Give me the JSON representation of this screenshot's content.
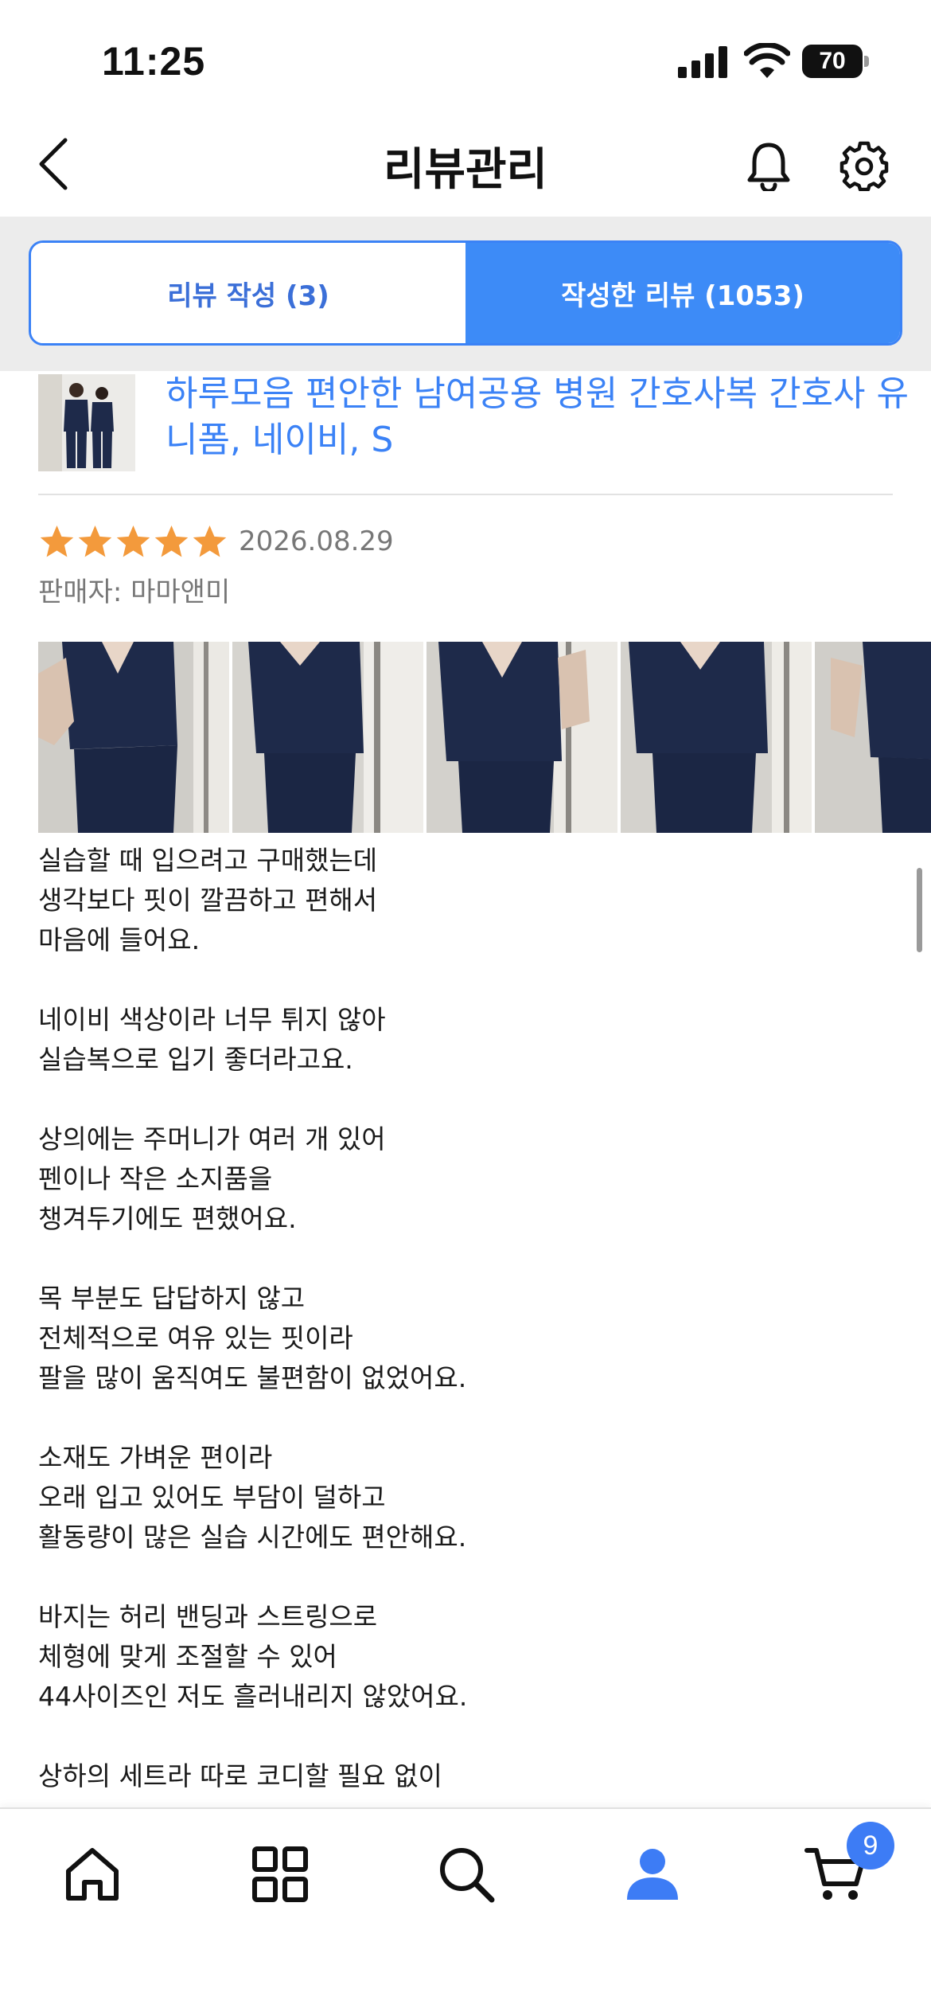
{
  "status_bar": {
    "time": "11:25",
    "battery": "70",
    "icons": [
      "signal-icon",
      "wifi-icon",
      "battery-icon"
    ]
  },
  "header": {
    "title": "리뷰관리",
    "icons": [
      "back-arrow-icon",
      "bell-icon",
      "gear-icon"
    ]
  },
  "tabs": [
    {
      "label": "리뷰 작성 (3)",
      "active": false
    },
    {
      "label": "작성한 리뷰 (1053)",
      "active": true
    }
  ],
  "review": {
    "product_title": "하루모음 편안한 남여공용 병원 간호사복 간호사 유니폼, 네이비, S",
    "rating": 5,
    "date": "2026.08.29",
    "seller": "판매자: 마마앤미",
    "photo_count_visible": 5,
    "text": "실습할 때 입으려고 구매했는데\n생각보다 핏이 깔끔하고 편해서\n마음에 들어요.\n\n네이비 색상이라 너무 튀지 않아\n실습복으로 입기 좋더라고요.\n\n상의에는 주머니가 여러 개 있어\n펜이나 작은 소지품을\n챙겨두기에도 편했어요.\n\n목 부분도 답답하지 않고\n전체적으로 여유 있는 핏이라\n팔을 많이 움직여도 불편함이 없었어요.\n\n소재도 가벼운 편이라\n오래 입고 있어도 부담이 덜하고\n활동량이 많은 실습 시간에도 편안해요.\n\n바지는 허리 밴딩과 스트링으로\n체형에 맞게 조절할 수 있어\n44사이즈인 저도 흘러내리지 않았어요.\n\n상하의 세트라 따로 코디할 필요 없이"
  },
  "bottom_nav": {
    "items": [
      "home-icon",
      "grid-icon",
      "search-icon",
      "profile-icon",
      "cart-icon"
    ],
    "active": "profile-icon",
    "cart_badge": "9"
  },
  "colors": {
    "accent": "#3d8bf7",
    "link": "#3b82f6",
    "star": "#f39a3c",
    "muted": "#777777",
    "uniform": "#1e2a4a"
  }
}
